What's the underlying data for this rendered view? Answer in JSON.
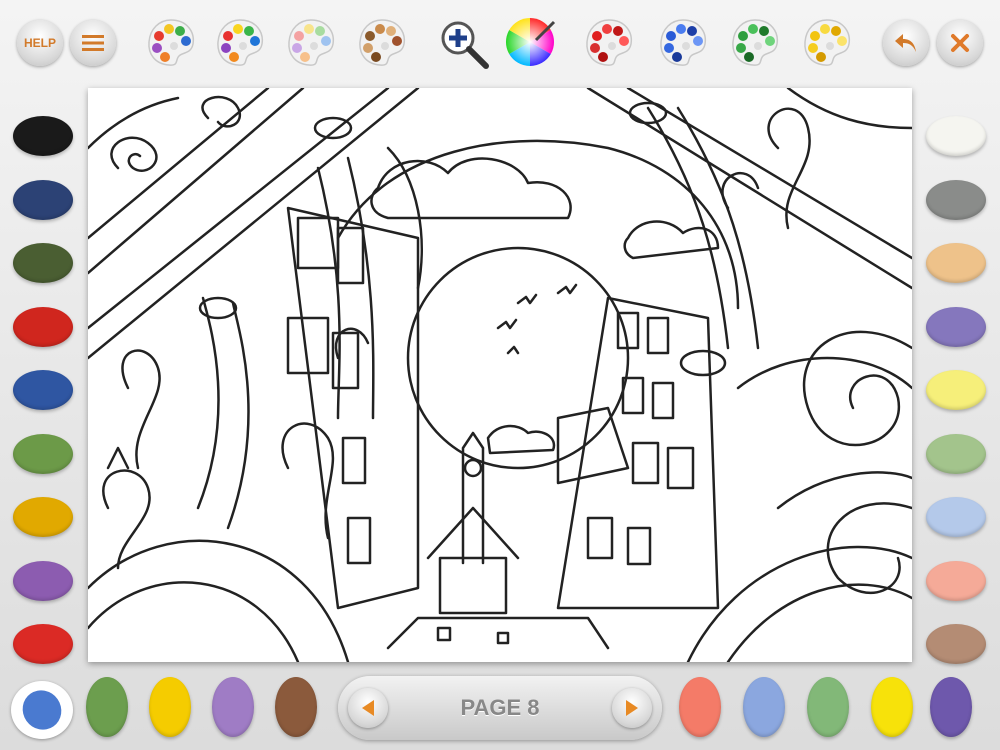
{
  "toolbar": {
    "help_label": "HELP",
    "buttons": [
      {
        "name": "help-button",
        "icon": "help-icon"
      },
      {
        "name": "menu-button",
        "icon": "hamburger-icon"
      },
      {
        "name": "zoom-button",
        "icon": "zoom-in-icon"
      },
      {
        "name": "color-wheel-button",
        "icon": "color-wheel-icon"
      },
      {
        "name": "undo-button",
        "icon": "undo-icon"
      },
      {
        "name": "close-button",
        "icon": "close-icon"
      }
    ],
    "palettes_left": [
      {
        "name": "palette-multicolor",
        "dots": [
          "#e63b2e",
          "#f3c623",
          "#3cae4a",
          "#2e6bd1",
          "#9b4fc2",
          "#ef7f28"
        ]
      },
      {
        "name": "palette-bright",
        "dots": [
          "#e8312f",
          "#f9d51f",
          "#3ab54a",
          "#1f75d8",
          "#8c43c0",
          "#f28a1e"
        ]
      },
      {
        "name": "palette-pastel",
        "dots": [
          "#f4a2a2",
          "#f8e48c",
          "#a8dca0",
          "#9fc3f0",
          "#c9a6e6",
          "#f7c08a"
        ]
      },
      {
        "name": "palette-brown",
        "dots": [
          "#8b5a2b",
          "#c98a4b",
          "#e0b07a",
          "#a0522d",
          "#d2a06a",
          "#7a4a20"
        ]
      }
    ],
    "palettes_right": [
      {
        "name": "palette-red",
        "dots": [
          "#e02020",
          "#f04040",
          "#c01818",
          "#ff5a5a",
          "#d83030",
          "#b01010"
        ]
      },
      {
        "name": "palette-blue",
        "dots": [
          "#2a5bd7",
          "#4a7cf0",
          "#1d3fa8",
          "#6c96f5",
          "#3568e0",
          "#1a3a9a"
        ]
      },
      {
        "name": "palette-green",
        "dots": [
          "#2e9e3e",
          "#4ac05a",
          "#1f7a2b",
          "#6fd47c",
          "#38a848",
          "#1a6a26"
        ]
      },
      {
        "name": "palette-yellow",
        "dots": [
          "#f2c40f",
          "#f8da40",
          "#e0a800",
          "#fbe36a",
          "#f5cd20",
          "#d49a00"
        ]
      }
    ],
    "accent": "#e07a2a"
  },
  "left_colors": [
    "#1a1a1a",
    "#2c4275",
    "#4a5e32",
    "#d0261e",
    "#2f56a2",
    "#6c9a48",
    "#e1a900",
    "#8c5cb0",
    "#db2a25"
  ],
  "right_colors": [
    "#f5f5f0",
    "#8a8c8a",
    "#eec28a",
    "#8577bd",
    "#f6ef7a",
    "#a3c48c",
    "#b4c9ea",
    "#f5aa98",
    "#b48c74"
  ],
  "bottom_left_colors": [
    "#4a7ad0",
    "#6c9e4e",
    "#f5cc00",
    "#9f7cc5",
    "#8b5a3c"
  ],
  "bottom_right_colors": [
    "#f47b68",
    "#8ba7df",
    "#82b878",
    "#f7e20a",
    "#6e58ac"
  ],
  "pager": {
    "label": "PAGE 8",
    "prev_icon": "arrow-left-icon",
    "next_icon": "arrow-right-icon",
    "arrow_color": "#e88a24"
  }
}
